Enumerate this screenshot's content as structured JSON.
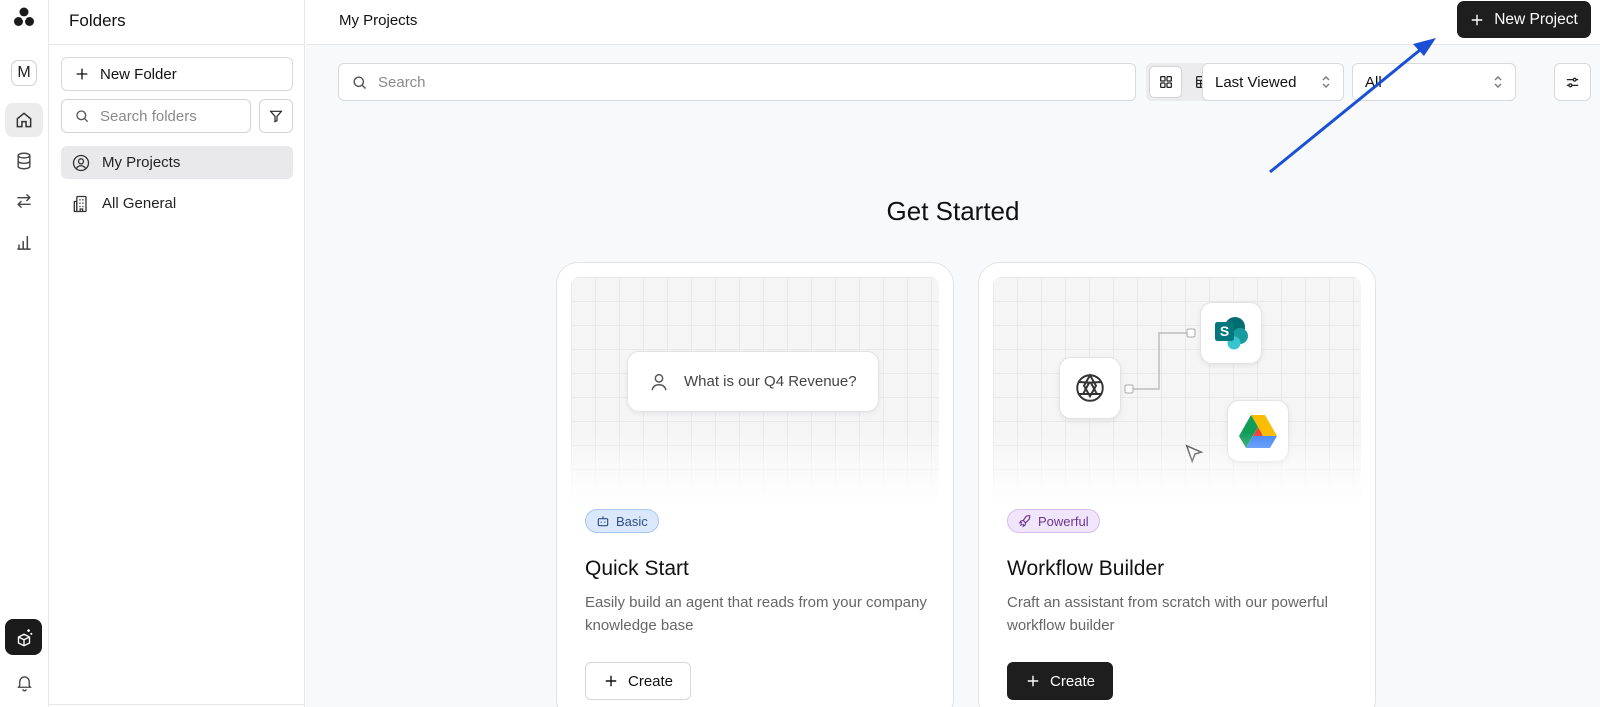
{
  "rail": {
    "avatar_letter": "M"
  },
  "sidebar": {
    "title": "Folders",
    "new_folder_label": "New Folder",
    "search_placeholder": "Search folders",
    "items": [
      {
        "label": "My Projects",
        "icon": "user-circle-icon",
        "active": true
      },
      {
        "label": "All General",
        "icon": "building-icon",
        "active": false
      }
    ]
  },
  "header": {
    "breadcrumb": "My Projects",
    "new_project_label": "New Project"
  },
  "toolbar": {
    "search_placeholder": "Search",
    "sort_value": "Last Viewed",
    "filter_value": "All"
  },
  "main": {
    "heading": "Get Started",
    "cards": [
      {
        "badge": "Basic",
        "title": "Quick Start",
        "description": "Easily build an agent that reads from your company knowledge base",
        "button": "Create",
        "illustration_text": "What is our Q4 Revenue?"
      },
      {
        "badge": "Powerful",
        "title": "Workflow Builder",
        "description": "Craft an assistant from scratch with our powerful workflow builder",
        "button": "Create"
      }
    ]
  },
  "colors": {
    "accent_dark": "#1e1e1e",
    "annotation_arrow": "#1a4fd6",
    "basic_badge_bg": "#dbe8fb",
    "powerful_badge_bg": "#f1e5fb"
  }
}
